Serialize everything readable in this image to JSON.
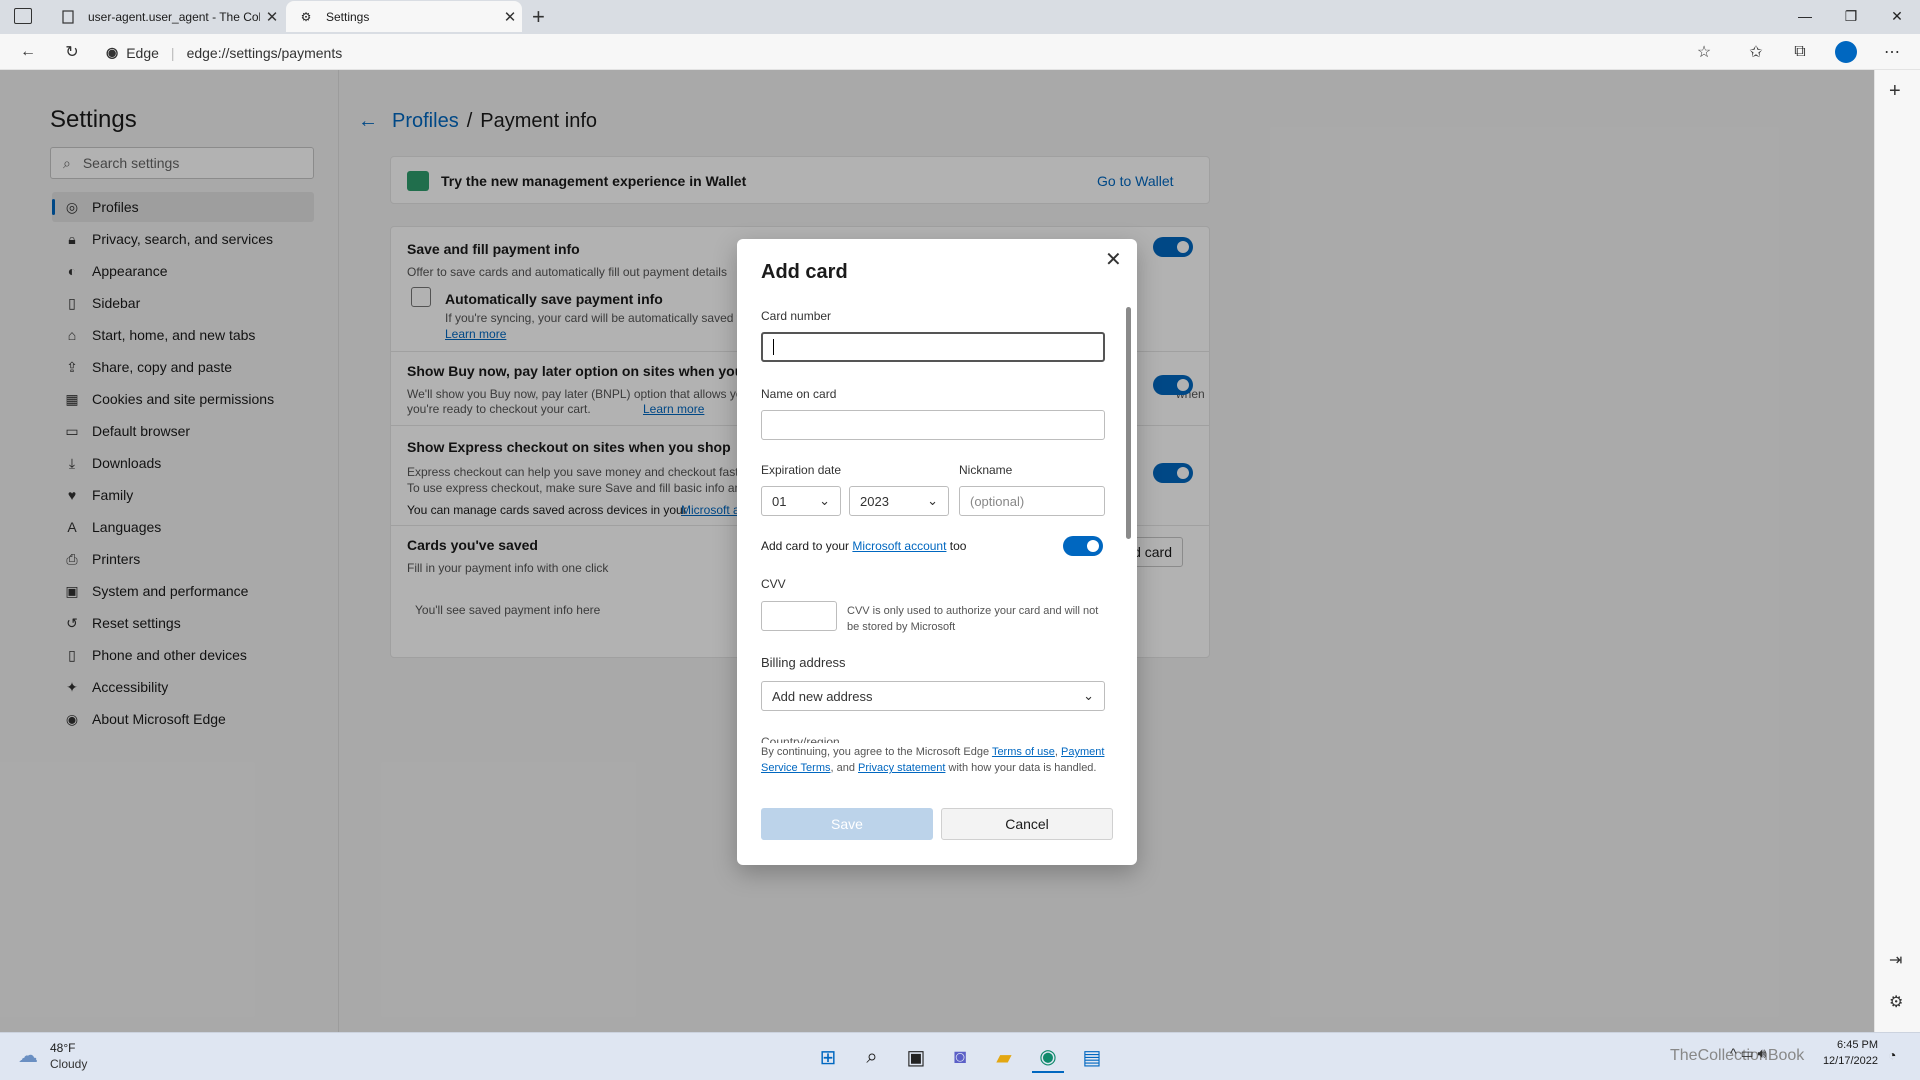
{
  "browser": {
    "tabs": [
      {
        "title": "user-agent.user_agent - The Coll",
        "active": false
      },
      {
        "title": "Settings",
        "active": true
      }
    ],
    "address": {
      "site": "Edge",
      "url": "edge://settings/payments"
    }
  },
  "settings": {
    "title": "Settings",
    "search_placeholder": "Search settings",
    "nav": [
      "Profiles",
      "Privacy, search, and services",
      "Appearance",
      "Sidebar",
      "Start, home, and new tabs",
      "Share, copy and paste",
      "Cookies and site permissions",
      "Default browser",
      "Downloads",
      "Family",
      "Languages",
      "Printers",
      "System and performance",
      "Reset settings",
      "Phone and other devices",
      "Accessibility",
      "About Microsoft Edge"
    ],
    "breadcrumb": {
      "parent": "Profiles",
      "current": "Payment info"
    },
    "wallet_banner": {
      "text": "Try the new management experience in Wallet",
      "link": "Go to Wallet"
    },
    "save_fill": {
      "title": "Save and fill payment info",
      "desc": "Offer to save cards and automatically fill out payment details"
    },
    "auto_save": {
      "title": "Automatically save payment info",
      "desc": "If you're syncing, your card will be automatically saved t",
      "learn_more": "Learn more"
    },
    "bnpl": {
      "title": "Show Buy now, pay later option on sites when you sh",
      "desc_line1": "We'll show you Buy now, pay later (BNPL) option that allows yo",
      "desc_tail": "when",
      "desc_line2": "you're ready to checkout your cart.",
      "learn_more": "Learn more"
    },
    "express": {
      "title": "Show Express checkout on sites when you shop",
      "desc_line1": "Express checkout can help you save money and checkout faste",
      "desc_line2": "To use express checkout, make sure Save and fill basic info and",
      "manage": "You can manage cards saved across devices in your",
      "manage_link": "Microsoft a"
    },
    "cards_saved": {
      "title": "Cards you've saved",
      "desc": "Fill in your payment info with one click",
      "empty": "You'll see saved payment info here",
      "add_button": "dd card"
    }
  },
  "dialog": {
    "title": "Add card",
    "card_number_label": "Card number",
    "name_label": "Name on card",
    "expiration_label": "Expiration date",
    "exp_month": "01",
    "exp_year": "2023",
    "nickname_label": "Nickname",
    "nickname_placeholder": "(optional)",
    "ms_account_prefix": "Add card to your",
    "ms_account_link": "Microsoft account",
    "ms_account_suffix": "too",
    "cvv_label": "CVV",
    "cvv_note": "CVV is only used to authorize your card and will not be stored by Microsoft",
    "billing_label": "Billing address",
    "billing_value": "Add new address",
    "country_label": "Country/region",
    "legal_prefix": "By continuing, you agree to the Microsoft Edge",
    "legal_terms": "Terms of use",
    "legal_pst": "Payment Service Terms",
    "legal_and": ", and",
    "legal_privacy": "Privacy statement",
    "legal_suffix": "with how your data is handled.",
    "save_button": "Save",
    "cancel_button": "Cancel"
  },
  "taskbar": {
    "weather_temp": "48°F",
    "weather_desc": "Cloudy",
    "time": "6:45 PM",
    "date": "12/17/2022",
    "watermark": "TheCollectionBook"
  },
  "colors": {
    "accent": "#0067c0",
    "page_bg": "#f3f3f3",
    "overlay": "rgba(0,0,0,0.30)"
  }
}
